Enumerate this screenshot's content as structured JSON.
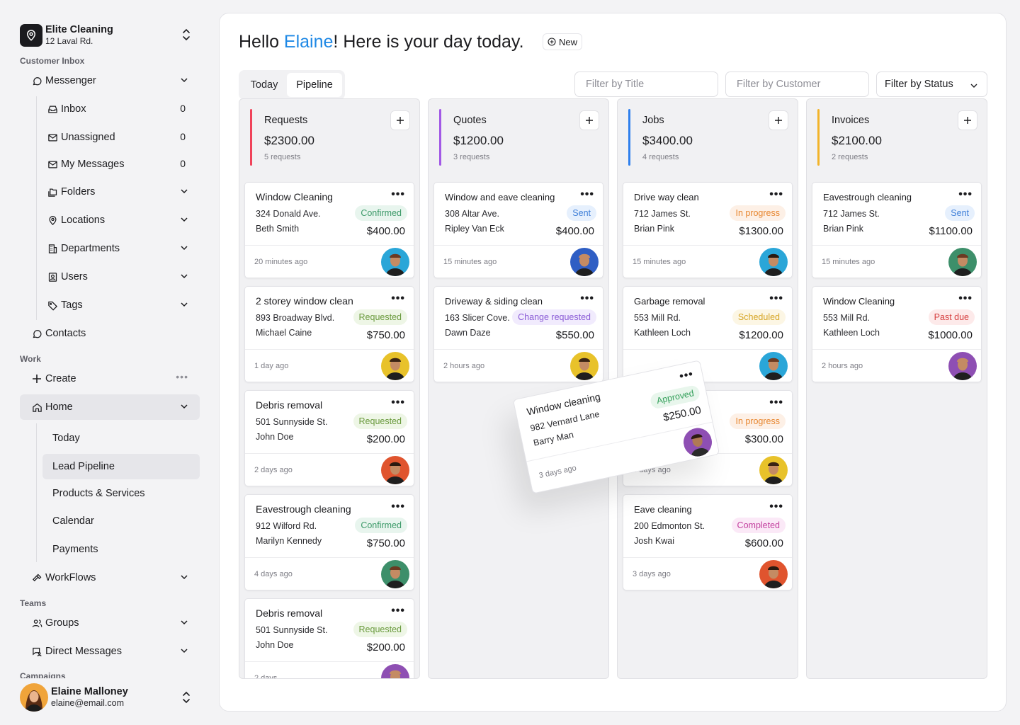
{
  "org": {
    "name": "Elite Cleaning",
    "address": "12 Laval Rd."
  },
  "sidebar": {
    "customer_inbox_label": "Customer Inbox",
    "messenger": "Messenger",
    "inbox": {
      "label": "Inbox",
      "count": "0"
    },
    "unassigned": {
      "label": "Unassigned",
      "count": "0"
    },
    "my_messages": {
      "label": "My Messages",
      "count": "0"
    },
    "folders": "Folders",
    "locations": "Locations",
    "departments": "Departments",
    "users": "Users",
    "tags": "Tags",
    "contacts": "Contacts",
    "work_label": "Work",
    "create": "Create",
    "home": "Home",
    "today": "Today",
    "lead_pipeline": "Lead Pipeline",
    "products": "Products & Services",
    "calendar": "Calendar",
    "payments": "Payments",
    "workflows": "WorkFlows",
    "teams_label": "Teams",
    "groups": "Groups",
    "direct_messages": "Direct Messages",
    "campaigns_label": "Campaigns"
  },
  "user": {
    "name": "Elaine Malloney",
    "email": "elaine@email.com"
  },
  "header": {
    "greet_pre": "Hello ",
    "greet_name": "Elaine",
    "greet_post": "! Here is your day today.",
    "new_label": "New"
  },
  "tabs": [
    "Today",
    "Pipeline"
  ],
  "filters": {
    "title": "Filter by Title",
    "customer": "Filter by Customer",
    "status": "Filter by Status"
  },
  "colors": {
    "requests": "#f0435a",
    "quotes": "#a259e6",
    "jobs": "#2f80ed",
    "invoices": "#f2b42a"
  },
  "columns": [
    {
      "title": "Requests",
      "amount": "$2300.00",
      "sub": "5 requests",
      "cards": [
        {
          "title": "Window Cleaning",
          "address": "324 Donald Ave.",
          "name": "Beth Smith",
          "status": "Confirmed",
          "price": "$400.00",
          "time": "20 minutes ago"
        },
        {
          "title": "2 storey window clean",
          "address": "893 Broadway Blvd.",
          "name": "Michael Caine",
          "status": "Requested",
          "price": "$750.00",
          "time": "1 day ago"
        },
        {
          "title": "Debris removal",
          "address": "501 Sunnyside St.",
          "name": "John Doe",
          "status": "Requested",
          "price": "$200.00",
          "time": "2 days ago"
        },
        {
          "title": "Eavestrough cleaning",
          "address": "912 Wilford Rd.",
          "name": "Marilyn Kennedy",
          "status": "Confirmed",
          "price": "$750.00",
          "time": "4 days ago"
        },
        {
          "title": "Debris removal",
          "address": "501 Sunnyside St.",
          "name": "John Doe",
          "status": "Requested",
          "price": "$200.00",
          "time": "2 days"
        }
      ]
    },
    {
      "title": "Quotes",
      "amount": "$1200.00",
      "sub": "3 requests",
      "cards": [
        {
          "title": "Window and eave cleaning",
          "address": "308 Altar Ave.",
          "name": "Ripley Van Eck",
          "status": "Sent",
          "price": "$400.00",
          "time": "15 minutes ago"
        },
        {
          "title": "Driveway & siding clean",
          "address": "163 Slicer Cove.",
          "name": "Dawn Daze",
          "status": "Change requested",
          "price": "$550.00",
          "time": "2 hours ago"
        }
      ]
    },
    {
      "title": "Jobs",
      "amount": "$3400.00",
      "sub": "4 requests",
      "cards": [
        {
          "title": "Drive way clean",
          "address": "712 James St.",
          "name": "Brian Pink",
          "status": "In progress",
          "price": "$1300.00",
          "time": "15 minutes ago"
        },
        {
          "title": "Garbage removal",
          "address": "553 Mill Rd.",
          "name": "Kathleen Loch",
          "status": "Scheduled",
          "price": "$1200.00",
          "time": ""
        },
        {
          "title": "",
          "address": "",
          "name": "",
          "status": "In progress",
          "price": "$300.00",
          "time": "3 days ago"
        },
        {
          "title": "Eave cleaning",
          "address": "200 Edmonton St.",
          "name": "Josh Kwai",
          "status": "Completed",
          "price": "$600.00",
          "time": "3 days ago"
        }
      ]
    },
    {
      "title": "Invoices",
      "amount": "$2100.00",
      "sub": "2 requests",
      "cards": [
        {
          "title": "Eavestrough cleaning",
          "address": "712 James St.",
          "name": "Brian Pink",
          "status": "Sent",
          "price": "$1100.00",
          "time": "15 minutes ago"
        },
        {
          "title": "Window Cleaning",
          "address": "553 Mill Rd.",
          "name": "Kathleen Loch",
          "status": "Past due",
          "price": "$1000.00",
          "time": "2 hours ago"
        }
      ]
    }
  ],
  "dragged_card": {
    "title": "Window cleaning",
    "address": "982 Vernard Lane",
    "name": "Barry Man",
    "status": "Approved",
    "price": "$250.00",
    "time": "3 days ago"
  }
}
